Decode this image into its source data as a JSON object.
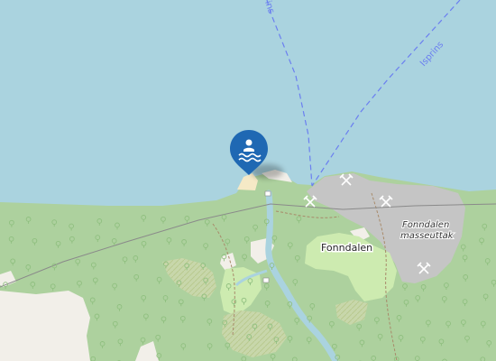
{
  "map": {
    "colors": {
      "water": "#aad3df",
      "forest": "#add19e",
      "meadow": "#cdebb0",
      "quarry": "#c5c5c5",
      "bare_ground": "#f2efe9",
      "scrub": "#c8d7ab",
      "beach": "#f5e9c6",
      "ferry_route": "#6b7ff0",
      "marker": "#1f68b3"
    },
    "labels": {
      "place": "Fonndalen",
      "quarry_line1": "Fonndalen",
      "quarry_line2": "masseuttak",
      "route_partial": "ins",
      "route_name": "Isprins"
    },
    "marker": {
      "icon": "swimming-icon"
    },
    "icons": {
      "quarry": "pick-and-shovel-icon",
      "woodland": "tree-icon"
    }
  }
}
